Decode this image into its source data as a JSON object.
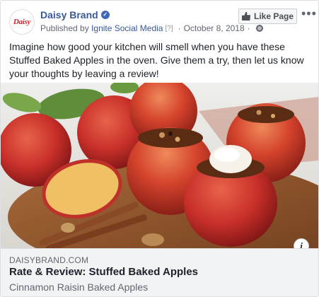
{
  "header": {
    "page_name": "Daisy Brand",
    "avatar_text": "Daisy",
    "published_by_prefix": "Published by",
    "publisher": "Ignite Social Media",
    "help_mark": "[?]",
    "date": "October 8, 2018",
    "separator": "·",
    "like_button_label": "Like Page",
    "more_label": "•••"
  },
  "post": {
    "text": "Imagine how good your kitchen will smell when you have these Stuffed Baked Apples in the oven. Give them a try, then let us know your thoughts by leaving a review!"
  },
  "link": {
    "domain": "DAISYBRAND.COM",
    "title": "Rate & Review: Stuffed Baked Apples",
    "description": "Cinnamon Raisin Baked Apples",
    "info_label": "i"
  },
  "colors": {
    "link_blue": "#385898",
    "brand_red": "#d2232a",
    "verified_blue": "#4267b2",
    "link_box_bg": "#f2f3f5"
  }
}
